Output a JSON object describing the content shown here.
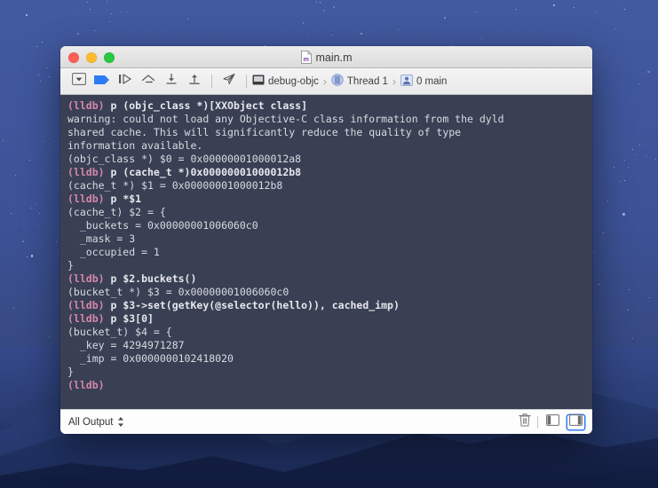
{
  "desktop": {
    "wallpaper_name": "el-capitan-night"
  },
  "window": {
    "title": "main.m",
    "doc_icon": "objc-m-file-icon",
    "controls": {
      "close_label": "close",
      "minimize_label": "minimize",
      "maximize_label": "maximize"
    }
  },
  "toolbar": {
    "buttons": [
      {
        "name": "show-hide-navigator-button",
        "icon": "triangle-in-box-icon",
        "label": "Hide/Show"
      },
      {
        "name": "breakpoints-button",
        "icon": "breakpoint-flag-icon",
        "label": "Breakpoints"
      },
      {
        "name": "continue-button",
        "icon": "continue-program-icon",
        "label": "Continue"
      },
      {
        "name": "step-over-button",
        "icon": "step-over-icon",
        "label": "Step Over"
      },
      {
        "name": "step-into-button",
        "icon": "step-into-icon",
        "label": "Step Into"
      },
      {
        "name": "step-out-button",
        "icon": "step-out-icon",
        "label": "Step Out"
      },
      {
        "name": "debug-view-hierarchy-button",
        "icon": "paper-plane-icon",
        "label": "Debug View Hierarchy"
      }
    ],
    "jumpbar": [
      {
        "name": "scheme",
        "icon": "process-icon",
        "label": "debug-objc"
      },
      {
        "name": "thread",
        "icon": "thread-icon",
        "label": "Thread 1"
      },
      {
        "name": "frame",
        "icon": "stack-frame-icon",
        "label": "0 main"
      }
    ],
    "chevron": "›"
  },
  "console": {
    "prompt": "(lldb)",
    "lines": [
      {
        "type": "cmd",
        "prompt": "(lldb)",
        "text": " p (objc_class *)[XXObject class]"
      },
      {
        "type": "output",
        "text": "warning: could not load any Objective-C class information from the dyld"
      },
      {
        "type": "output",
        "text": "shared cache. This will significantly reduce the quality of type"
      },
      {
        "type": "output",
        "text": "information available."
      },
      {
        "type": "output",
        "text": "(objc_class *) $0 = 0x00000001000012a8"
      },
      {
        "type": "cmd",
        "prompt": "(lldb)",
        "text": " p (cache_t *)0x00000001000012b8"
      },
      {
        "type": "output",
        "text": "(cache_t *) $1 = 0x00000001000012b8"
      },
      {
        "type": "cmd",
        "prompt": "(lldb)",
        "text": " p *$1"
      },
      {
        "type": "output",
        "text": "(cache_t) $2 = {"
      },
      {
        "type": "output",
        "text": "  _buckets = 0x00000001006060c0"
      },
      {
        "type": "output",
        "text": "  _mask = 3"
      },
      {
        "type": "output",
        "text": "  _occupied = 1"
      },
      {
        "type": "output",
        "text": "}"
      },
      {
        "type": "cmd",
        "prompt": "(lldb)",
        "text": " p $2.buckets()"
      },
      {
        "type": "output",
        "text": "(bucket_t *) $3 = 0x00000001006060c0"
      },
      {
        "type": "cmd",
        "prompt": "(lldb)",
        "text": " p $3->set(getKey(@selector(hello)), cached_imp)"
      },
      {
        "type": "cmd",
        "prompt": "(lldb)",
        "text": " p $3[0]"
      },
      {
        "type": "output",
        "text": "(bucket_t) $4 = {"
      },
      {
        "type": "output",
        "text": "  _key = 4294971287"
      },
      {
        "type": "output",
        "text": "  _imp = 0x0000000102418020"
      },
      {
        "type": "output",
        "text": "}"
      },
      {
        "type": "cmd",
        "prompt": "(lldb)",
        "text": ""
      }
    ],
    "colors": {
      "background": "#3a4053",
      "text": "#d8dbe3",
      "prompt": "#d487ab"
    }
  },
  "statusbar": {
    "output_filter": "All Output",
    "stepper_icon": "up-down-chevron-icon",
    "clear_label": "Clear Console",
    "clear_icon": "trash-icon",
    "left_panel_icon": "show-variables-view-icon",
    "right_panel_icon": "show-console-view-icon",
    "active_panel": "console"
  }
}
